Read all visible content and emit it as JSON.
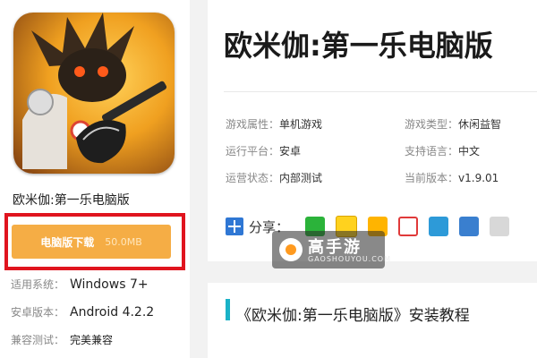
{
  "sidebar": {
    "app_name": "欧米伽:第一乐电脑版",
    "download_label": "电脑版下载",
    "download_size": "50.0MB",
    "specs": [
      {
        "key": "适用系统：",
        "value": "Windows 7+"
      },
      {
        "key": "安卓版本：",
        "value": "Android 4.2.2"
      },
      {
        "key": "兼容测试：",
        "value": "完美兼容"
      }
    ]
  },
  "main": {
    "title": "欧米伽:第一乐电脑版",
    "attributes": [
      {
        "key": "游戏属性：",
        "value": "单机游戏"
      },
      {
        "key": "游戏类型：",
        "value": "休闲益智"
      },
      {
        "key": "运行平台：",
        "value": "安卓"
      },
      {
        "key": "支持语言：",
        "value": "中文"
      },
      {
        "key": "运营状态：",
        "value": "内部测试"
      },
      {
        "key": "当前版本：",
        "value": "v1.9.01"
      }
    ],
    "share_label": "分享：",
    "share_icons": [
      "wechat-icon",
      "qq-icon",
      "qzone-icon",
      "weibo-icon",
      "tencent-weibo-icon",
      "print-icon",
      "copy-icon"
    ]
  },
  "watermark": {
    "name": "高手游",
    "sub": "GAOSHOUYOU.COM"
  },
  "section": {
    "title": "《欧米伽:第一乐电脑版》安装教程"
  },
  "colors": {
    "download_button": "#f5ad45",
    "highlight_border": "#e0141e",
    "section_bar": "#1ab2c7"
  }
}
